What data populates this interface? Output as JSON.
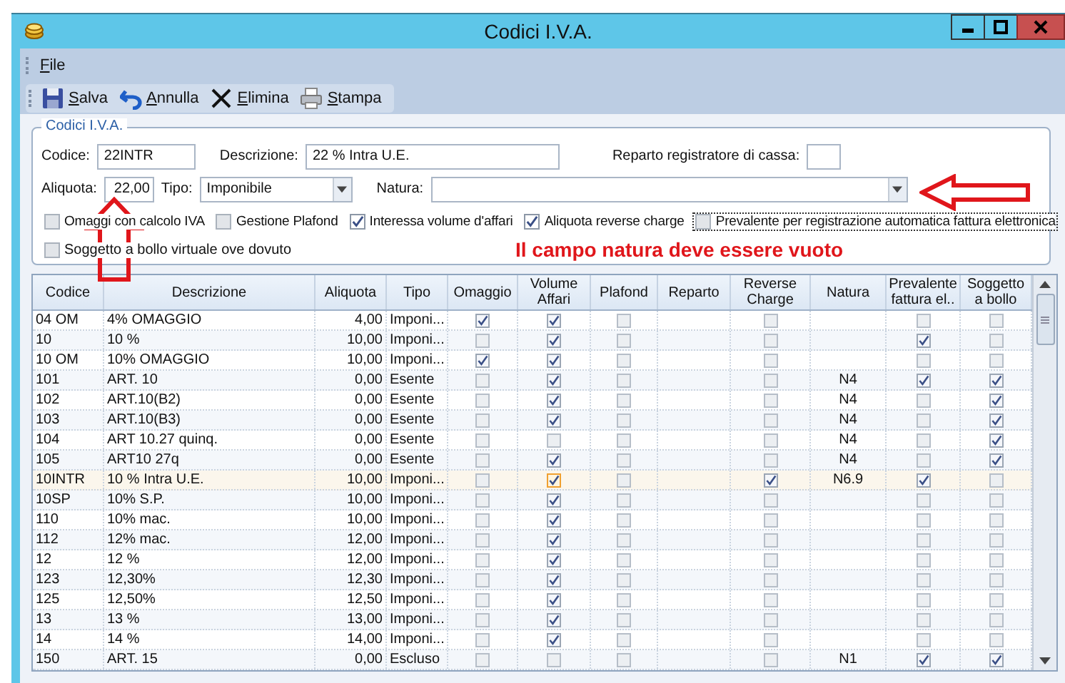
{
  "window": {
    "title": "Codici I.V.A."
  },
  "menu": [
    {
      "label": "File"
    }
  ],
  "toolbar": [
    {
      "label": "Salva",
      "kind": "save"
    },
    {
      "label": "Annulla",
      "kind": "undo"
    },
    {
      "label": "Elimina",
      "kind": "delete"
    },
    {
      "label": "Stampa",
      "kind": "print"
    }
  ],
  "form": {
    "legend": "Codici I.V.A.",
    "codice": {
      "label": "Codice:",
      "value": "22INTR"
    },
    "descrizione": {
      "label": "Descrizione:",
      "value": "22 % Intra U.E."
    },
    "reparto": {
      "label": "Reparto registratore di cassa:"
    },
    "aliquota": {
      "label": "Aliquota:",
      "value": "22,00"
    },
    "tipo": {
      "label": "Tipo:",
      "value": "Imponibile"
    },
    "natura": {
      "label": "Natura:"
    },
    "checkboxes": [
      {
        "label": "Omaggi con calcolo IVA",
        "checked": false,
        "focused": false
      },
      {
        "label": "Gestione Plafond",
        "checked": false,
        "focused": false
      },
      {
        "label": "Interessa volume d'affari",
        "checked": true,
        "focused": false
      },
      {
        "label": "Aliquota reverse charge",
        "checked": true,
        "focused": false
      },
      {
        "label": "Prevalente per registrazione automatica fattura elettronica",
        "checked": false,
        "focused": true
      },
      {
        "label": "Soggetto a bollo virtuale ove dovuto",
        "checked": false,
        "focused": false
      }
    ]
  },
  "annotation": {
    "text": "Il campo natura deve essere vuoto"
  },
  "table": {
    "columns": [
      "Codice",
      "Descrizione",
      "Aliquota",
      "Tipo",
      "Omaggio",
      "Volume\nAffari",
      "Plafond",
      "Reparto",
      "Reverse\nCharge",
      "Natura",
      "Prevalente\nfattura el..",
      "Soggetto\na  bollo"
    ],
    "rows": [
      {
        "codice": "04 OM",
        "descrizione": "4% OMAGGIO",
        "aliquota": "4,00",
        "tipo": "Imponi...",
        "omaggio": true,
        "volume_affari": true,
        "plafond": false,
        "reverse_charge": false,
        "prevalente": false,
        "soggetto_bollo": false,
        "selected": false
      },
      {
        "codice": "10",
        "descrizione": "10 %",
        "aliquota": "10,00",
        "tipo": "Imponi...",
        "omaggio": false,
        "volume_affari": true,
        "plafond": false,
        "reverse_charge": false,
        "prevalente": true,
        "soggetto_bollo": false,
        "selected": false
      },
      {
        "codice": "10 OM",
        "descrizione": "10% OMAGGIO",
        "aliquota": "10,00",
        "tipo": "Imponi...",
        "omaggio": true,
        "volume_affari": true,
        "plafond": false,
        "reverse_charge": false,
        "prevalente": false,
        "soggetto_bollo": false,
        "selected": false
      },
      {
        "codice": "101",
        "descrizione": "ART. 10",
        "aliquota": "0,00",
        "tipo": "Esente",
        "omaggio": false,
        "volume_affari": true,
        "plafond": false,
        "reverse_charge": false,
        "natura": "N4",
        "prevalente": true,
        "soggetto_bollo": true,
        "selected": false
      },
      {
        "codice": "102",
        "descrizione": "ART.10(B2)",
        "aliquota": "0,00",
        "tipo": "Esente",
        "omaggio": false,
        "volume_affari": true,
        "plafond": false,
        "reverse_charge": false,
        "natura": "N4",
        "prevalente": false,
        "soggetto_bollo": true,
        "selected": false
      },
      {
        "codice": "103",
        "descrizione": "ART.10(B3)",
        "aliquota": "0,00",
        "tipo": "Esente",
        "omaggio": false,
        "volume_affari": true,
        "plafond": false,
        "reverse_charge": false,
        "natura": "N4",
        "prevalente": false,
        "soggetto_bollo": true,
        "selected": false
      },
      {
        "codice": "104",
        "descrizione": "ART 10.27 quinq.",
        "aliquota": "0,00",
        "tipo": "Esente",
        "omaggio": false,
        "volume_affari": false,
        "plafond": false,
        "reverse_charge": false,
        "natura": "N4",
        "prevalente": false,
        "soggetto_bollo": true,
        "selected": false
      },
      {
        "codice": "105",
        "descrizione": "ART10 27q",
        "aliquota": "0,00",
        "tipo": "Esente",
        "omaggio": false,
        "volume_affari": true,
        "plafond": false,
        "reverse_charge": false,
        "natura": "N4",
        "prevalente": false,
        "soggetto_bollo": true,
        "selected": false
      },
      {
        "codice": "10INTR",
        "descrizione": "10 % Intra U.E.",
        "aliquota": "10,00",
        "tipo": "Imponi...",
        "omaggio": false,
        "volume_affari": true,
        "plafond": false,
        "reverse_charge": true,
        "natura": "N6.9",
        "prevalente": true,
        "soggetto_bollo": false,
        "selected": true
      },
      {
        "codice": "10SP",
        "descrizione": "10% S.P.",
        "aliquota": "10,00",
        "tipo": "Imponi...",
        "omaggio": false,
        "volume_affari": true,
        "plafond": false,
        "reverse_charge": false,
        "prevalente": false,
        "soggetto_bollo": false,
        "selected": false
      },
      {
        "codice": "110",
        "descrizione": "10% mac.",
        "aliquota": "10,00",
        "tipo": "Imponi...",
        "omaggio": false,
        "volume_affari": true,
        "plafond": false,
        "reverse_charge": false,
        "prevalente": false,
        "soggetto_bollo": false,
        "selected": false
      },
      {
        "codice": "112",
        "descrizione": "12% mac.",
        "aliquota": "12,00",
        "tipo": "Imponi...",
        "omaggio": false,
        "volume_affari": true,
        "plafond": false,
        "reverse_charge": false,
        "prevalente": false,
        "soggetto_bollo": false,
        "selected": false
      },
      {
        "codice": "12",
        "descrizione": "12 %",
        "aliquota": "12,00",
        "tipo": "Imponi...",
        "omaggio": false,
        "volume_affari": true,
        "plafond": false,
        "reverse_charge": false,
        "prevalente": false,
        "soggetto_bollo": false,
        "selected": false
      },
      {
        "codice": "123",
        "descrizione": "12,30%",
        "aliquota": "12,30",
        "tipo": "Imponi...",
        "omaggio": false,
        "volume_affari": true,
        "plafond": false,
        "reverse_charge": false,
        "prevalente": false,
        "soggetto_bollo": false,
        "selected": false
      },
      {
        "codice": "125",
        "descrizione": "12,50%",
        "aliquota": "12,50",
        "tipo": "Imponi...",
        "omaggio": false,
        "volume_affari": true,
        "plafond": false,
        "reverse_charge": false,
        "prevalente": false,
        "soggetto_bollo": false,
        "selected": false
      },
      {
        "codice": "13",
        "descrizione": "13 %",
        "aliquota": "13,00",
        "tipo": "Imponi...",
        "omaggio": false,
        "volume_affari": true,
        "plafond": false,
        "reverse_charge": false,
        "prevalente": false,
        "soggetto_bollo": false,
        "selected": false
      },
      {
        "codice": "14",
        "descrizione": "14 %",
        "aliquota": "14,00",
        "tipo": "Imponi...",
        "omaggio": false,
        "volume_affari": true,
        "plafond": false,
        "reverse_charge": false,
        "prevalente": false,
        "soggetto_bollo": false,
        "selected": false
      },
      {
        "codice": "150",
        "descrizione": "ART. 15",
        "aliquota": "0,00",
        "tipo": "Escluso",
        "omaggio": false,
        "volume_affari": false,
        "plafond": false,
        "reverse_charge": false,
        "natura": "N1",
        "prevalente": true,
        "soggetto_bollo": true,
        "selected": false
      }
    ]
  }
}
